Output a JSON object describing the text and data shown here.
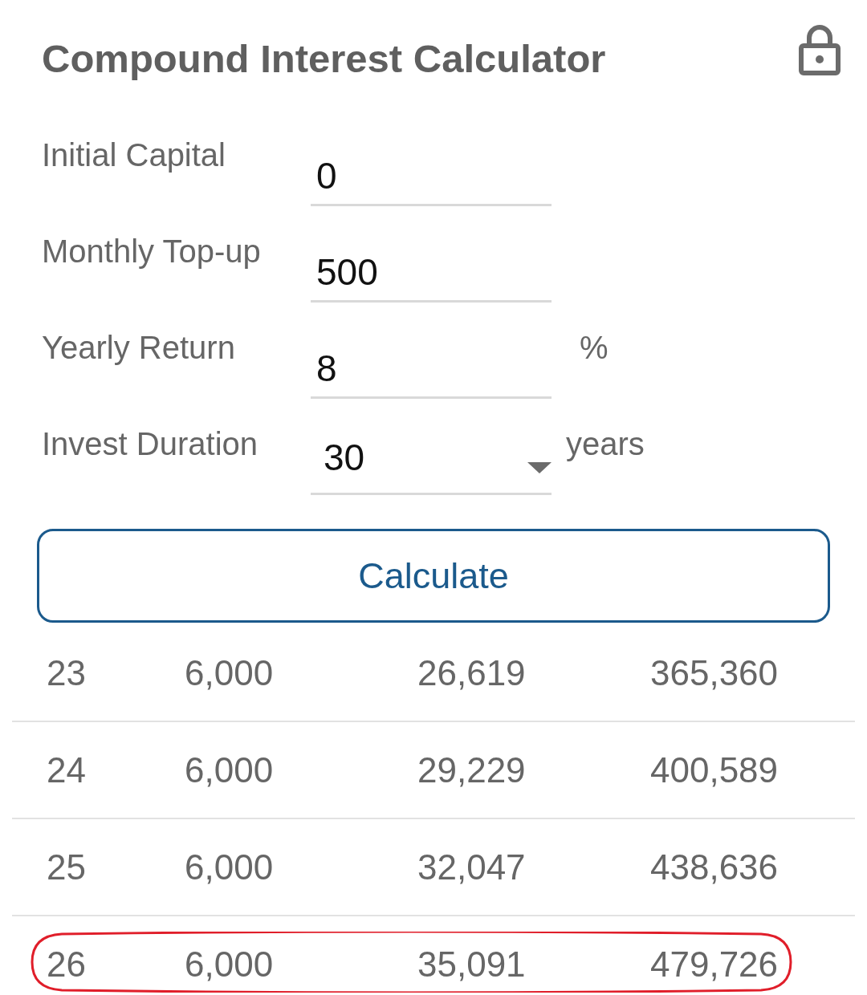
{
  "header": {
    "title": "Compound Interest Calculator"
  },
  "form": {
    "fields": [
      {
        "kind": "text",
        "label": "Initial Capital",
        "value": "0"
      },
      {
        "kind": "text",
        "label": "Monthly Top-up",
        "value": "500"
      },
      {
        "kind": "text",
        "label": "Yearly Return",
        "value": "8",
        "unit": "%"
      },
      {
        "kind": "dropdown",
        "label": "Invest Duration",
        "value": "30",
        "unit": "years"
      }
    ]
  },
  "calculate_button": {
    "label": "Calculate"
  },
  "table": {
    "rows": [
      {
        "cells": [
          "23",
          "6,000",
          "26,619",
          "365,360"
        ],
        "highlighted": false
      },
      {
        "cells": [
          "24",
          "6,000",
          "29,229",
          "400,589"
        ],
        "highlighted": false
      },
      {
        "cells": [
          "25",
          "6,000",
          "32,047",
          "438,636"
        ],
        "highlighted": false
      },
      {
        "cells": [
          "26",
          "6,000",
          "35,091",
          "479,726"
        ],
        "highlighted": true
      }
    ]
  }
}
